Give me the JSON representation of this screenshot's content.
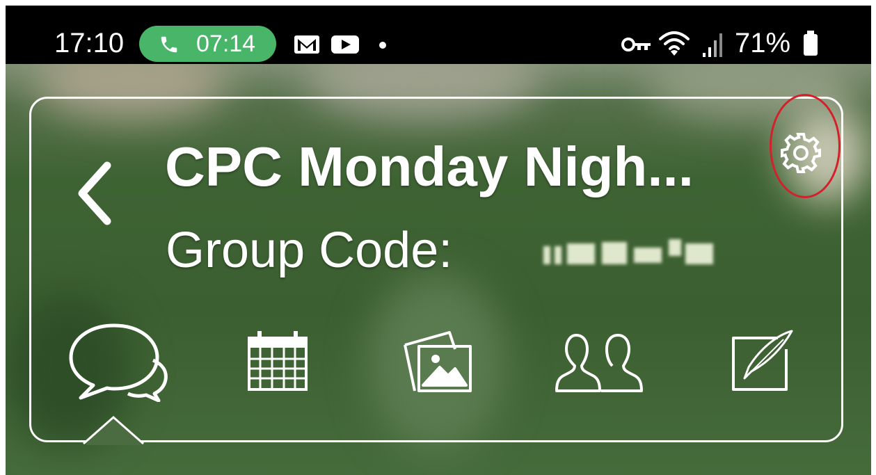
{
  "status_bar": {
    "time": "17:10",
    "call_duration": "07:14",
    "battery_percent": "71%",
    "icons": [
      "phone-icon",
      "gmail-icon",
      "youtube-icon",
      "dot-icon",
      "vpn-key-icon",
      "wifi-icon",
      "signal-icon",
      "battery-icon"
    ]
  },
  "header": {
    "title": "CPC Monday Nigh...",
    "group_code_label": "Group Code:"
  },
  "tabs": [
    {
      "name": "chat",
      "icon": "chat-bubbles-icon",
      "selected": true
    },
    {
      "name": "calendar",
      "icon": "calendar-icon"
    },
    {
      "name": "photos",
      "icon": "photos-icon"
    },
    {
      "name": "members",
      "icon": "members-icon"
    },
    {
      "name": "notes",
      "icon": "quill-note-icon"
    }
  ],
  "colors": {
    "status_bar": "#000000",
    "call_pill": "#48b568",
    "accent": "#ffffff",
    "highlight_ring": "#d4202a"
  }
}
